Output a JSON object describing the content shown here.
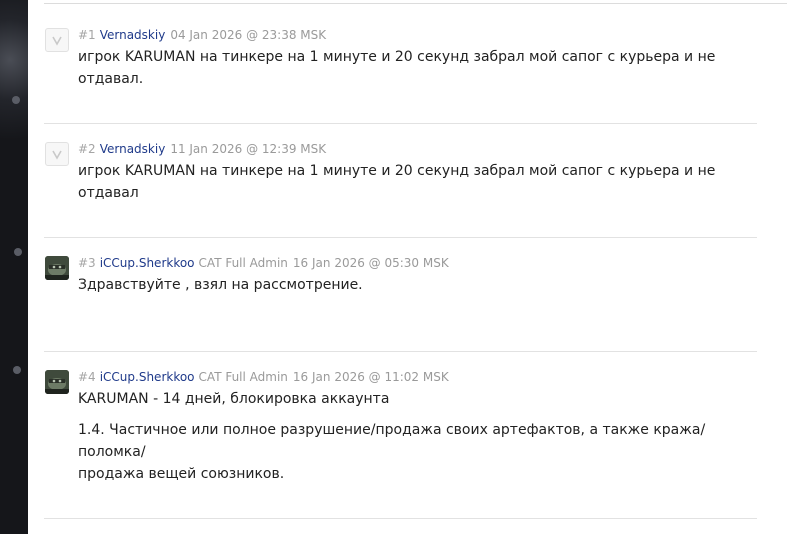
{
  "posts": [
    {
      "num": "#1",
      "user": "Vernadskiy",
      "role": "",
      "date": "04 Jan 2026 @ 23:38 MSK",
      "lines": [
        "игрок KARUMAN на тинкере на 1 минуте и 20 секунд забрал мой сапог с курьера и не отдавал."
      ],
      "avatar": "blank-avatar-icon"
    },
    {
      "num": "#2",
      "user": "Vernadskiy",
      "role": "",
      "date": "11 Jan 2026 @ 12:39 MSK",
      "lines": [
        "игрок KARUMAN на тинкере на 1 минуте и 20 секунд забрал мой сапог с курьера и не отдавал"
      ],
      "avatar": "blank-avatar-icon"
    },
    {
      "num": "#3",
      "user": "iCCup.Sherkkoo",
      "role": "CAT Full Admin",
      "date": "16 Jan 2026 @ 05:30 MSK",
      "lines": [
        "Здравствуйте , взял на рассмотрение."
      ],
      "avatar": "user-avatar-image"
    },
    {
      "num": "#4",
      "user": "iCCup.Sherkkoo",
      "role": "CAT Full Admin",
      "date": "16 Jan 2026 @ 11:02 MSK",
      "lines": [
        "KARUMAN - 14 дней, блокировка аккаунта",
        "1.4. Частичное или полное разрушение/продажа своих артефактов, а также кража/поломка/",
        "продажа вещей союзников."
      ],
      "avatar": "user-avatar-image"
    }
  ]
}
